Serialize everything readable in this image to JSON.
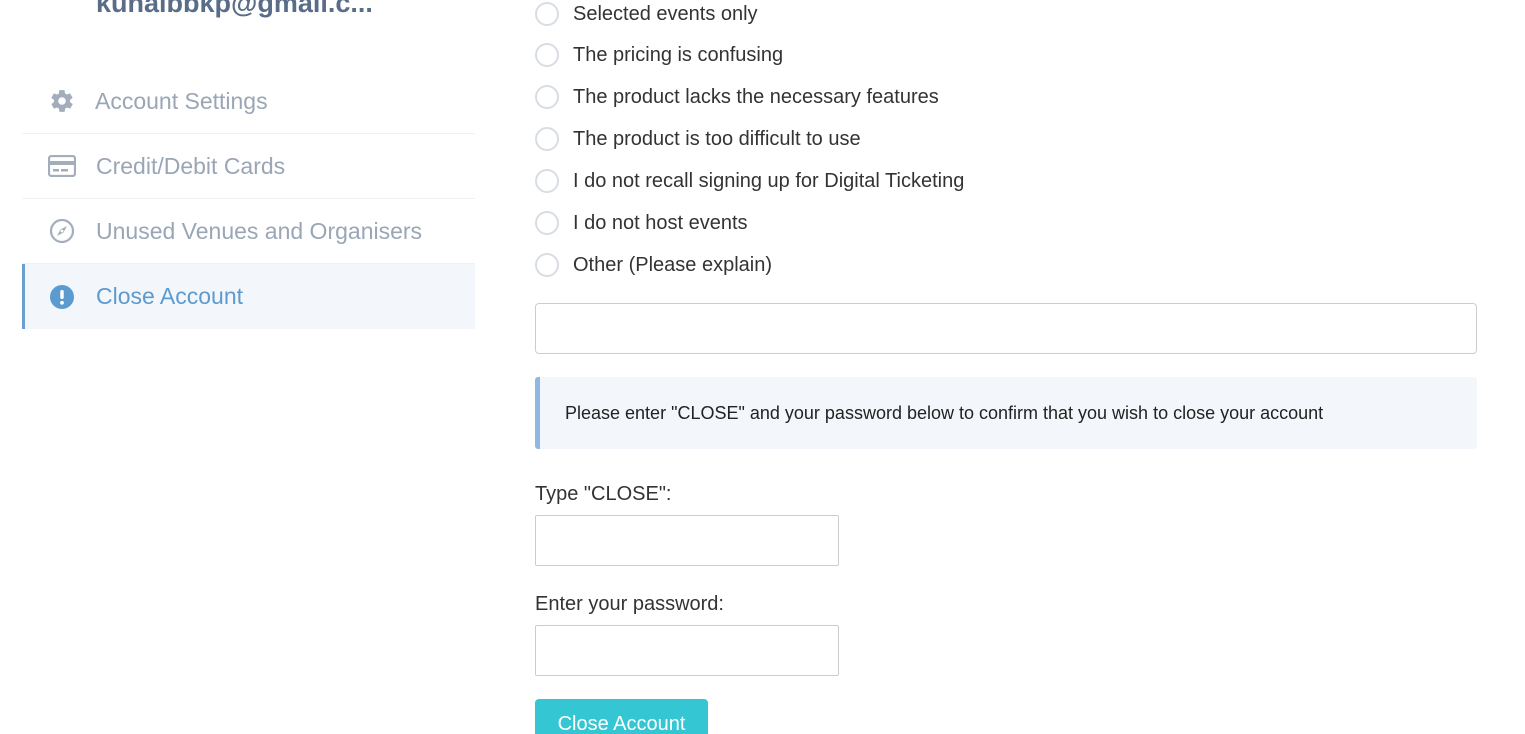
{
  "sidebar": {
    "email": "kunalbbkp@gmail.c...",
    "items": [
      {
        "label": "Account Settings",
        "icon": "gear-icon"
      },
      {
        "label": "Credit/Debit Cards",
        "icon": "credit-card-icon"
      },
      {
        "label": "Unused Venues and Organisers",
        "icon": "compass-icon"
      },
      {
        "label": "Close Account",
        "icon": "exclamation-circle-icon",
        "active": true
      }
    ]
  },
  "reasons": {
    "options": [
      "Selected events only",
      "The pricing is confusing",
      "The product lacks the necessary features",
      "The product is too difficult to use",
      "I do not recall signing up for Digital Ticketing",
      "I do not host events",
      "Other (Please explain)"
    ],
    "explain_value": ""
  },
  "confirm": {
    "notice": "Please enter \"CLOSE\" and your password below to confirm that you wish to close your account",
    "type_close_label": "Type \"CLOSE\":",
    "type_close_value": "",
    "password_label": "Enter your password:",
    "password_value": "",
    "submit_label": "Close Account"
  },
  "colors": {
    "accent": "#35c6d3",
    "active_nav": "#5b9bd0",
    "nav_text": "#9aa6b6",
    "notice_border": "#8fb8e3"
  }
}
